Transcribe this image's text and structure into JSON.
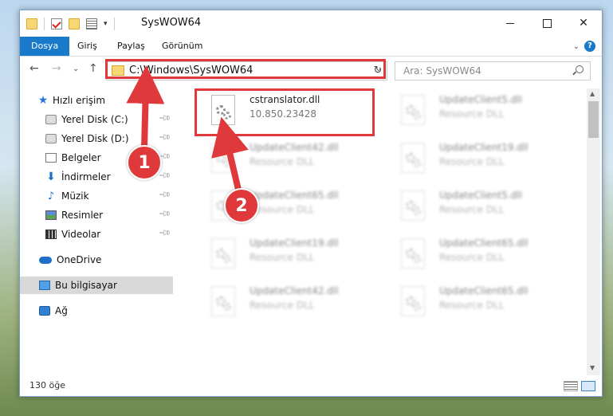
{
  "window": {
    "title": "SysWOW64"
  },
  "ribbon": {
    "tabs": [
      "Dosya",
      "Giriş",
      "Paylaş",
      "Görünüm"
    ],
    "active_tab": "Dosya"
  },
  "address": {
    "path": "C:\\Windows\\SysWOW64"
  },
  "search": {
    "placeholder": "Ara: SysWOW64"
  },
  "sidebar": {
    "items": [
      {
        "label": "Hızlı erişim",
        "icon": "star-icon"
      },
      {
        "label": "Yerel Disk (C:)",
        "icon": "disk-icon",
        "pinned": true
      },
      {
        "label": "Yerel Disk (D:)",
        "icon": "disk-icon",
        "pinned": true
      },
      {
        "label": "Belgeler",
        "icon": "document-icon",
        "pinned": true
      },
      {
        "label": "İndirmeler",
        "icon": "download-icon",
        "pinned": true
      },
      {
        "label": "Müzik",
        "icon": "music-icon",
        "pinned": true
      },
      {
        "label": "Resimler",
        "icon": "pictures-icon",
        "pinned": true
      },
      {
        "label": "Videolar",
        "icon": "videos-icon",
        "pinned": true
      },
      {
        "label": "OneDrive",
        "icon": "cloud-icon"
      },
      {
        "label": "Bu bilgisayar",
        "icon": "computer-icon",
        "selected": true
      },
      {
        "label": "Ağ",
        "icon": "network-icon"
      }
    ]
  },
  "files": [
    {
      "name": "cstranslator.dll",
      "sub": "10.850.23428",
      "highlighted": true
    },
    {
      "name": "UpdateClient5.dll",
      "sub": "Resource DLL"
    },
    {
      "name": "UpdateClient42.dll",
      "sub": "Resource DLL"
    },
    {
      "name": "UpdateClient19.dll",
      "sub": "Resource DLL"
    },
    {
      "name": "UpdateClient65.dll",
      "sub": "Resource DLL"
    },
    {
      "name": "UpdateClient5.dll",
      "sub": "Resource DLL"
    },
    {
      "name": "UpdateClient19.dll",
      "sub": "Resource DLL"
    },
    {
      "name": "UpdateClient65.dll",
      "sub": "Resource DLL"
    },
    {
      "name": "UpdateClient42.dll",
      "sub": "Resource DLL"
    },
    {
      "name": "UpdateClient65.dll",
      "sub": "Resource DLL"
    }
  ],
  "status": {
    "item_count": "130 öğe"
  },
  "annotations": {
    "step1": "1",
    "step2": "2",
    "color": "#e0393c"
  }
}
